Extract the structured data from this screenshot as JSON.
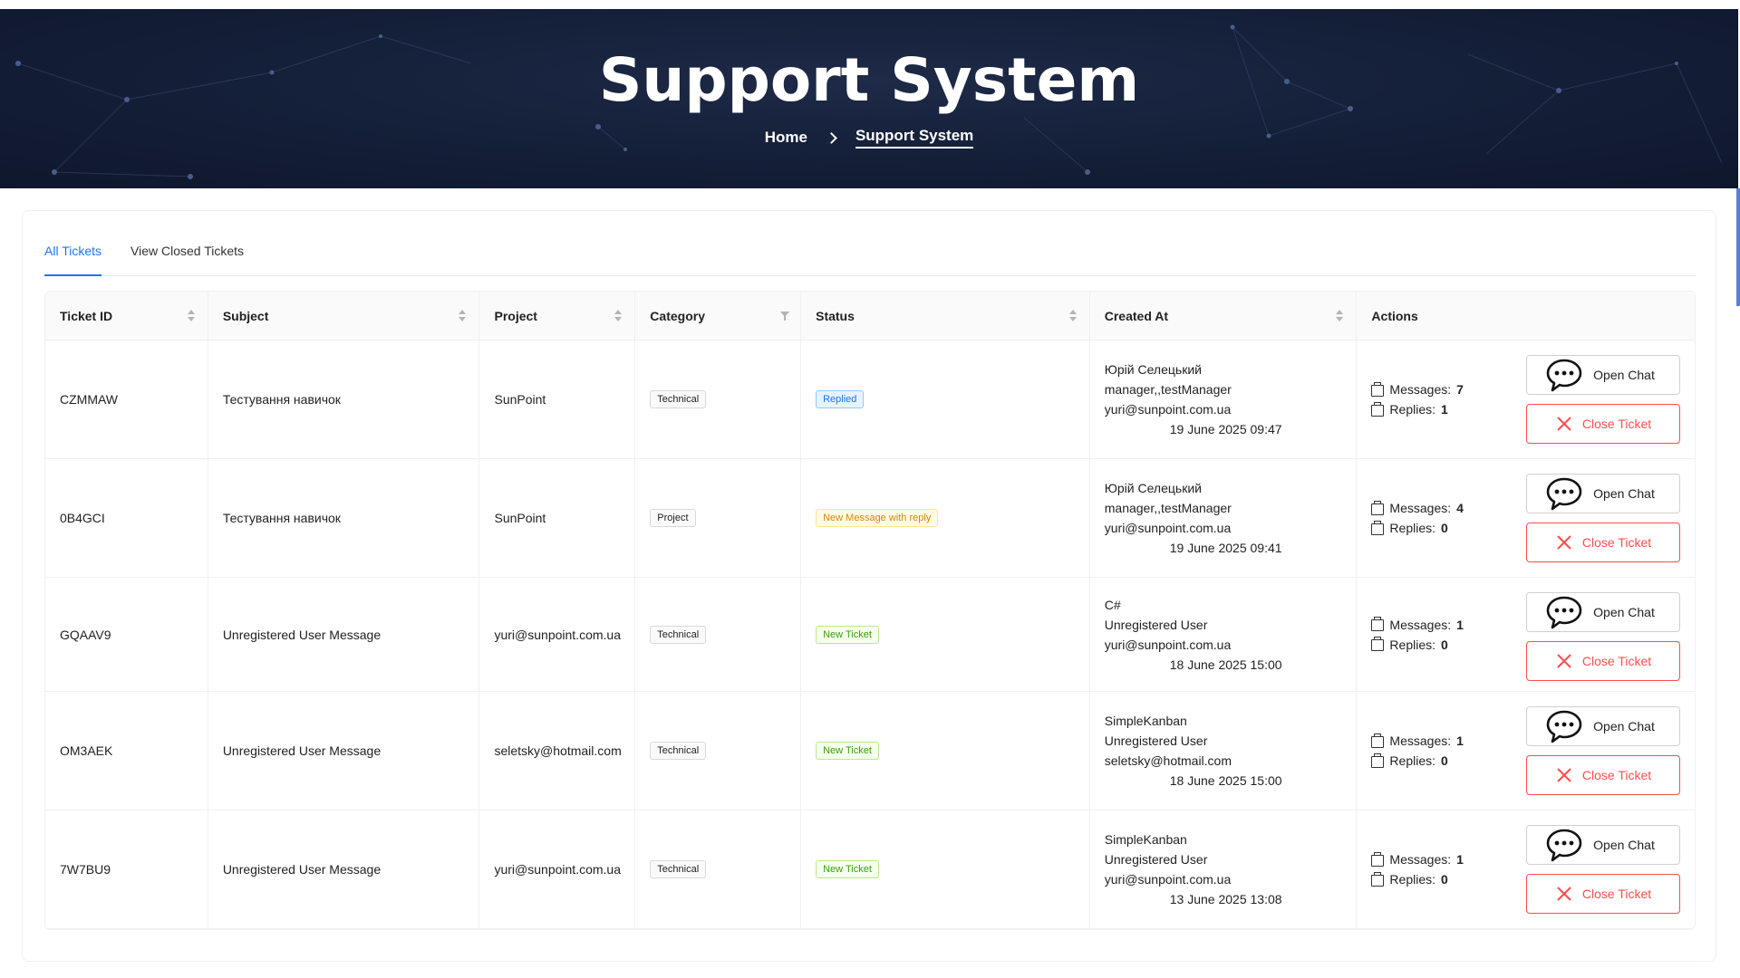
{
  "hero": {
    "title": "Support System",
    "breadcrumb": {
      "home": "Home",
      "current": "Support System"
    }
  },
  "tabs": [
    {
      "label": "All Tickets",
      "active": true
    },
    {
      "label": "View Closed Tickets",
      "active": false
    }
  ],
  "table": {
    "columns": [
      "Ticket ID",
      "Subject",
      "Project",
      "Category",
      "Status",
      "Created At",
      "Actions"
    ],
    "rows": [
      {
        "id": "CZMMAW",
        "subject": "Тестування навичок",
        "project": "SunPoint",
        "category": "Technical",
        "status": "Replied",
        "status_color": "blue",
        "created": {
          "line1": "Юрій Селецький",
          "line2": "manager,,testManager",
          "line3": "yuri@sunpoint.com.ua",
          "date": "19 June 2025 09:47"
        },
        "messages_label": "Messages:",
        "messages": "7",
        "replies_label": "Replies:",
        "replies": "1"
      },
      {
        "id": "0B4GCI",
        "subject": "Тестування навичок",
        "project": "SunPoint",
        "category": "Project",
        "status": "New Message with reply",
        "status_color": "gold",
        "created": {
          "line1": "Юрій Селецький",
          "line2": "manager,,testManager",
          "line3": "yuri@sunpoint.com.ua",
          "date": "19 June 2025 09:41"
        },
        "messages_label": "Messages:",
        "messages": "4",
        "replies_label": "Replies:",
        "replies": "0"
      },
      {
        "id": "GQAAV9",
        "subject": "Unregistered User Message",
        "project": "yuri@sunpoint.com.ua",
        "category": "Technical",
        "status": "New Ticket",
        "status_color": "green",
        "created": {
          "line1": "C#",
          "line2": "Unregistered User",
          "line3": "yuri@sunpoint.com.ua",
          "date": "18 June 2025 15:00"
        },
        "messages_label": "Messages:",
        "messages": "1",
        "replies_label": "Replies:",
        "replies": "0"
      },
      {
        "id": "OM3AEK",
        "subject": "Unregistered User Message",
        "project": "seletsky@hotmail.com",
        "category": "Technical",
        "status": "New Ticket",
        "status_color": "green",
        "created": {
          "line1": "SimpleKanban",
          "line2": "Unregistered User",
          "line3": "seletsky@hotmail.com",
          "date": "18 June 2025 15:00"
        },
        "messages_label": "Messages:",
        "messages": "1",
        "replies_label": "Replies:",
        "replies": "0"
      },
      {
        "id": "7W7BU9",
        "subject": "Unregistered User Message",
        "project": "yuri@sunpoint.com.ua",
        "category": "Technical",
        "status": "New Ticket",
        "status_color": "green",
        "created": {
          "line1": "SimpleKanban",
          "line2": "Unregistered User",
          "line3": "yuri@sunpoint.com.ua",
          "date": "13 June 2025 13:08"
        },
        "messages_label": "Messages:",
        "messages": "1",
        "replies_label": "Replies:",
        "replies": "0"
      }
    ],
    "open_chat_label": "Open Chat",
    "close_ticket_label": "Close Ticket"
  },
  "icons": {
    "chat": "chat-bubble-icon",
    "close": "close-x-icon",
    "messages": "briefcase-icon",
    "sort": "sort-icon",
    "filter": "filter-icon"
  },
  "colors": {
    "accent": "#1677ff",
    "danger": "#ff4d4f",
    "hero_bg": "#15203a"
  }
}
